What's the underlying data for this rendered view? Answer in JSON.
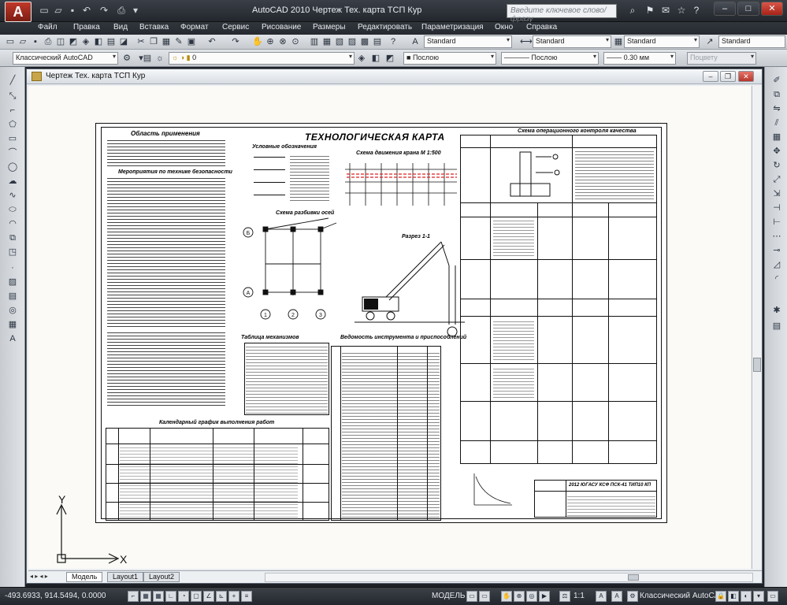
{
  "app": {
    "title": "AutoCAD 2010   Чертеж Тех. карта ТСП Кур",
    "logo_letter": "A",
    "search_placeholder": "Введите ключевое слово/фразу"
  },
  "menu": [
    "Файл",
    "Правка",
    "Вид",
    "Вставка",
    "Формат",
    "Сервис",
    "Рисование",
    "Размеры",
    "Редактировать",
    "Параметризация",
    "Окно",
    "Справка"
  ],
  "toolbar1": {
    "style1": "Standard",
    "style2": "Standard",
    "style3": "Standard",
    "style4": "Standard"
  },
  "toolbar2": {
    "workspace": "Классический AutoCAD",
    "layer": "0",
    "color": "Послою",
    "linetype": "Послою",
    "lineweight": "0.30 мм",
    "plotstyle": "Поцвету"
  },
  "drawing": {
    "window_title": "Чертеж Тех. карта ТСП Кур",
    "sheet_title": "ТЕХНОЛОГИЧЕСКАЯ КАРТА",
    "headings": {
      "scope": "Область применения",
      "safety": "Мероприятия по технике безопасности",
      "legend": "Условные обозначения",
      "crane_scheme": "Схема движения крана М 1:500",
      "frame_scheme": "Схема разбивки осей",
      "section": "Разрез 1-1",
      "quality": "Схема операционного контроля качества",
      "tools_table": "Ведомость инструмента и приспособлений",
      "machines_table": "Таблица механизмов",
      "schedule": "Календарный график выполнения работ",
      "plate": "2012 ЮГАСУ КСФ ПСК-41 ТИП10 КП",
      "axis_labels": [
        "1",
        "2",
        "3",
        "Б",
        "А"
      ]
    }
  },
  "tabs": [
    "Модель",
    "Layout1",
    "Layout2"
  ],
  "ucs": {
    "x_label": "X",
    "y_label": "Y"
  },
  "status": {
    "coords": "-493.6933, 914.5494, 0.0000",
    "model": "МОДЕЛЬ",
    "scale": "1:1",
    "workspace": "Классический AutoCAD"
  }
}
